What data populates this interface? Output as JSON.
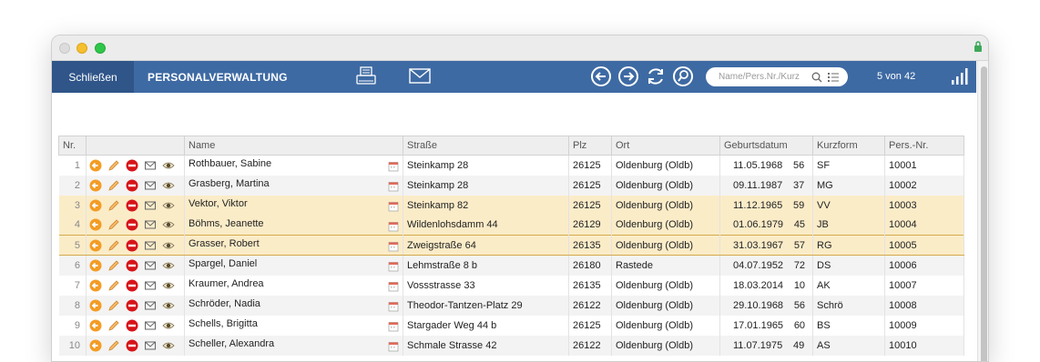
{
  "toolbar": {
    "close_label": "Schließen",
    "title": "PERSONALVERWALTUNG",
    "search_placeholder": "Name/Pers.Nr./Kurz",
    "counter": "5 von 42",
    "accent": "#3e6aa3"
  },
  "table": {
    "headers": [
      "Nr.",
      "",
      "Name",
      "Straße",
      "Plz",
      "Ort",
      "Geburtsdatum",
      "Kurzform",
      "Pers.-Nr."
    ],
    "rows": [
      {
        "nr": "1",
        "name": "Rothbauer, Sabine",
        "strasse": "Steinkamp 28",
        "plz": "26125",
        "ort": "Oldenburg (Oldb)",
        "geb": "11.05.1968",
        "alter": "56",
        "kurz": "SF",
        "pnr": "10001"
      },
      {
        "nr": "2",
        "name": "Grasberg, Martina",
        "strasse": "Steinkamp 28",
        "plz": "26125",
        "ort": "Oldenburg (Oldb)",
        "geb": "09.11.1987",
        "alter": "37",
        "kurz": "MG",
        "pnr": "10002"
      },
      {
        "nr": "3",
        "name": "Vektor, Viktor",
        "strasse": "Steinkamp 82",
        "plz": "26125",
        "ort": "Oldenburg (Oldb)",
        "geb": "11.12.1965",
        "alter": "59",
        "kurz": "VV",
        "pnr": "10003"
      },
      {
        "nr": "4",
        "name": "Böhms, Jeanette",
        "strasse": "Wildenlohsdamm 44",
        "plz": "26129",
        "ort": "Oldenburg (Oldb)",
        "geb": "01.06.1979",
        "alter": "45",
        "kurz": "JB",
        "pnr": "10004"
      },
      {
        "nr": "5",
        "name": "Grasser, Robert",
        "strasse": "Zweigstraße 64",
        "plz": "26135",
        "ort": "Oldenburg (Oldb)",
        "geb": "31.03.1967",
        "alter": "57",
        "kurz": "RG",
        "pnr": "10005"
      },
      {
        "nr": "6",
        "name": "Spargel, Daniel",
        "strasse": "Lehmstraße 8 b",
        "plz": "26180",
        "ort": "Rastede",
        "geb": "04.07.1952",
        "alter": "72",
        "kurz": "DS",
        "pnr": "10006"
      },
      {
        "nr": "7",
        "name": "Kraumer, Andrea",
        "strasse": "Vossstrasse 33",
        "plz": "26135",
        "ort": "Oldenburg (Oldb)",
        "geb": "18.03.2014",
        "alter": "10",
        "kurz": "AK",
        "pnr": "10007"
      },
      {
        "nr": "8",
        "name": "Schröder, Nadia",
        "strasse": "Theodor-Tantzen-Platz 29",
        "plz": "26122",
        "ort": "Oldenburg (Oldb)",
        "geb": "29.10.1968",
        "alter": "56",
        "kurz": "Schrö",
        "pnr": "10008"
      },
      {
        "nr": "9",
        "name": "Schells, Brigitta",
        "strasse": "Stargader Weg 44 b",
        "plz": "26125",
        "ort": "Oldenburg (Oldb)",
        "geb": "17.01.1965",
        "alter": "60",
        "kurz": "BS",
        "pnr": "10009"
      },
      {
        "nr": "10",
        "name": "Scheller, Alexandra",
        "strasse": "Schmale Strasse 42",
        "plz": "26122",
        "ort": "Oldenburg (Oldb)",
        "geb": "11.07.1975",
        "alter": "49",
        "kurz": "AS",
        "pnr": "10010"
      }
    ],
    "highlighted_rows": [
      "3",
      "4"
    ],
    "selected_row": "5"
  },
  "icons": [
    "back-arrow-icon",
    "edit-pencil-icon",
    "delete-icon",
    "mail-icon",
    "view-eye-icon",
    "calendar-icon",
    "printer-icon",
    "envelope-icon",
    "nav-back-icon",
    "nav-forward-icon",
    "refresh-icon",
    "search-icon",
    "list-icon",
    "signal-bars-icon",
    "lock-icon"
  ]
}
